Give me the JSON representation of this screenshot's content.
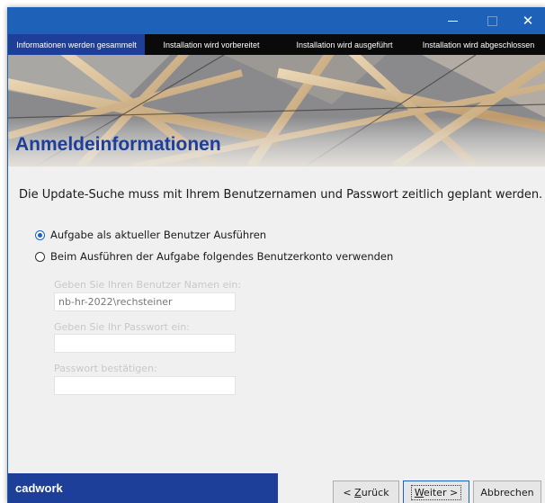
{
  "window": {
    "controls": {
      "minimize": "—",
      "maximize": "☐",
      "close": "✕"
    },
    "accent_color": "#1d62b8",
    "brand_color": "#1d3f9a"
  },
  "steps": [
    {
      "label": "Informationen werden gesammelt",
      "active": true
    },
    {
      "label": "Installation wird vorbereitet",
      "active": false
    },
    {
      "label": "Installation wird ausgeführt",
      "active": false
    },
    {
      "label": "Installation wird abgeschlossen",
      "active": false
    }
  ],
  "page": {
    "title": "Anmeldeinformationen",
    "intro": "Die Update-Suche muss mit Ihrem Benutzernamen und Passwort zeitlich geplant werden."
  },
  "options": [
    {
      "label": "Aufgabe als aktueller Benutzer Ausführen",
      "checked": true
    },
    {
      "label": "Beim Ausführen der Aufgabe folgendes Benutzerkonto verwenden",
      "checked": false
    }
  ],
  "fields": {
    "username": {
      "label": "Geben Sie Ihren Benutzer Namen ein:",
      "value": "nb-hr-2022\\rechsteiner"
    },
    "password": {
      "label": "Geben Sie Ihr Passwort ein:",
      "value": ""
    },
    "confirm": {
      "label": "Passwort bestätigen:",
      "value": ""
    }
  },
  "footer": {
    "brand": "cadwork",
    "back_label": "< Zurück",
    "back_mnemonic": "Z",
    "next_label": "Weiter >",
    "next_mnemonic": "W",
    "cancel_label": "Abbrechen"
  }
}
